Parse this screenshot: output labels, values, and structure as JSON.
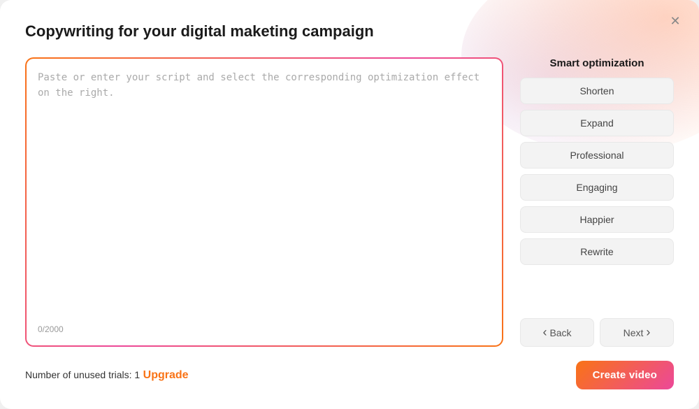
{
  "modal": {
    "title": "Copywriting for your digital maketing campaign",
    "close_label": "✕"
  },
  "textarea": {
    "placeholder": "Paste or enter your script and select the corresponding optimization effect on the right.",
    "value": "",
    "char_count": "0/2000"
  },
  "optimization": {
    "title": "Smart optimization",
    "buttons": [
      {
        "label": "Shorten",
        "id": "shorten"
      },
      {
        "label": "Expand",
        "id": "expand"
      },
      {
        "label": "Professional",
        "id": "professional"
      },
      {
        "label": "Engaging",
        "id": "engaging"
      },
      {
        "label": "Happier",
        "id": "happier"
      },
      {
        "label": "Rewrite",
        "id": "rewrite"
      }
    ]
  },
  "navigation": {
    "back_label": "Back",
    "next_label": "Next"
  },
  "footer": {
    "trials_text": "Number of unused trials: 1",
    "upgrade_label": "Upgrade",
    "create_video_label": "Create video"
  }
}
